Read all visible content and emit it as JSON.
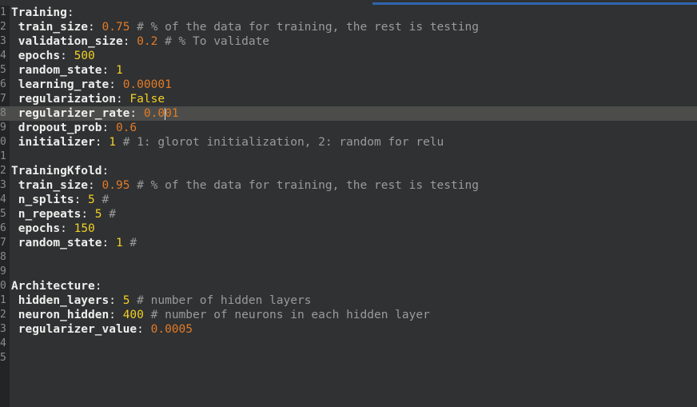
{
  "editor": {
    "colors": {
      "background": "#2f3133",
      "accent": "#2f65ad",
      "key": "#eeeeec",
      "number_orange": "#e27b27",
      "number_yellow": "#f2d024",
      "comment": "#9a9b99"
    },
    "lines": [
      {
        "n": "1",
        "indent": "",
        "key": "Training",
        "sep": ":",
        "value": "",
        "vclass": "",
        "comment": ""
      },
      {
        "n": "2",
        "indent": " ",
        "key": "train_size",
        "sep": ": ",
        "value": "0.75",
        "vclass": "num-o",
        "comment": " # % of the data for training, the rest is testing"
      },
      {
        "n": "3",
        "indent": " ",
        "key": "validation_size",
        "sep": ": ",
        "value": "0.2",
        "vclass": "num-o",
        "comment": " # % To validate"
      },
      {
        "n": "4",
        "indent": " ",
        "key": "epochs",
        "sep": ": ",
        "value": "500",
        "vclass": "num-y",
        "comment": ""
      },
      {
        "n": "5",
        "indent": " ",
        "key": "random_state",
        "sep": ": ",
        "value": "1",
        "vclass": "num-y",
        "comment": ""
      },
      {
        "n": "6",
        "indent": " ",
        "key": "learning_rate",
        "sep": ": ",
        "value": "0.00001",
        "vclass": "num-o",
        "comment": ""
      },
      {
        "n": "7",
        "indent": " ",
        "key": "regularization",
        "sep": ": ",
        "value": "False",
        "vclass": "bool",
        "comment": ""
      },
      {
        "n": "8",
        "indent": " ",
        "key": "regularizer_rate",
        "sep": ": ",
        "value": "0.001",
        "vclass": "num-o",
        "comment": "",
        "current": true
      },
      {
        "n": "9",
        "indent": " ",
        "key": "dropout_prob",
        "sep": ": ",
        "value": "0.6",
        "vclass": "num-o",
        "comment": ""
      },
      {
        "n": "0",
        "indent": " ",
        "key": "initializer",
        "sep": ": ",
        "value": "1",
        "vclass": "num-y",
        "comment": " # 1: glorot initialization, 2: random for relu"
      },
      {
        "n": "1",
        "indent": "",
        "key": "",
        "sep": "",
        "value": "",
        "vclass": "",
        "comment": ""
      },
      {
        "n": "2",
        "indent": "",
        "key": "TrainingKfold",
        "sep": ":",
        "value": "",
        "vclass": "",
        "comment": ""
      },
      {
        "n": "3",
        "indent": " ",
        "key": "train_size",
        "sep": ": ",
        "value": "0.95",
        "vclass": "num-o",
        "comment": " # % of the data for training, the rest is testing"
      },
      {
        "n": "4",
        "indent": " ",
        "key": "n_splits",
        "sep": ": ",
        "value": "5",
        "vclass": "num-y",
        "comment": " #"
      },
      {
        "n": "5",
        "indent": " ",
        "key": "n_repeats",
        "sep": ": ",
        "value": "5",
        "vclass": "num-y",
        "comment": " #"
      },
      {
        "n": "6",
        "indent": " ",
        "key": "epochs",
        "sep": ": ",
        "value": "150",
        "vclass": "num-y",
        "comment": ""
      },
      {
        "n": "7",
        "indent": " ",
        "key": "random_state",
        "sep": ": ",
        "value": "1",
        "vclass": "num-y",
        "comment": " #"
      },
      {
        "n": "8",
        "indent": "",
        "key": "",
        "sep": "",
        "value": "",
        "vclass": "",
        "comment": ""
      },
      {
        "n": "9",
        "indent": "",
        "key": "",
        "sep": "",
        "value": "",
        "vclass": "",
        "comment": ""
      },
      {
        "n": "0",
        "indent": "",
        "key": "Architecture",
        "sep": ":",
        "value": "",
        "vclass": "",
        "comment": ""
      },
      {
        "n": "1",
        "indent": " ",
        "key": "hidden_layers",
        "sep": ": ",
        "value": "5",
        "vclass": "num-y",
        "comment": " # number of hidden layers"
      },
      {
        "n": "2",
        "indent": " ",
        "key": "neuron_hidden",
        "sep": ": ",
        "value": "400",
        "vclass": "num-y",
        "comment": " # number of neurons in each hidden layer"
      },
      {
        "n": "3",
        "indent": " ",
        "key": "regularizer_value",
        "sep": ": ",
        "value": "0.0005",
        "vclass": "num-o",
        "comment": ""
      },
      {
        "n": "4",
        "indent": "",
        "key": "",
        "sep": "",
        "value": "",
        "vclass": "",
        "comment": ""
      },
      {
        "n": "5",
        "indent": "",
        "key": "",
        "sep": "",
        "value": "",
        "vclass": "",
        "comment": ""
      }
    ]
  }
}
